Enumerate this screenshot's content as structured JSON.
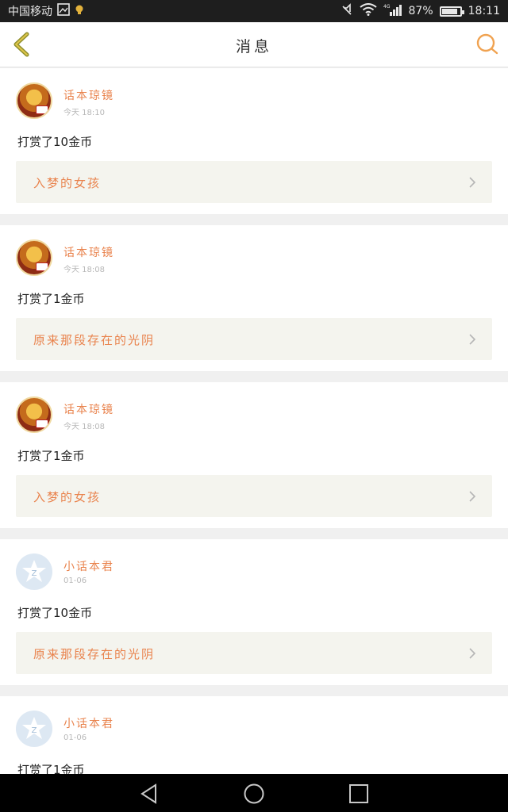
{
  "status_bar": {
    "carrier": "中国移动",
    "network": "4G",
    "battery": "87%",
    "battery_level": 0.87,
    "time": "18:11"
  },
  "header": {
    "title": "消息",
    "back_icon": "chevron-left-icon",
    "search_icon": "search-icon"
  },
  "colors": {
    "accent": "#e9834d",
    "back_icon": "#9a9a3c",
    "card_bg": "#ffffff",
    "story_bg": "#f4f4ee",
    "page_bg": "#f0f0f0"
  },
  "messages": [
    {
      "user": "话本琼镜",
      "time": "今天 18:10",
      "action": "打赏了10金币",
      "story": "入梦的女孩",
      "avatar": "photo"
    },
    {
      "user": "话本琼镜",
      "time": "今天 18:08",
      "action": "打赏了1金币",
      "story": "原来那段存在的光阴",
      "avatar": "photo"
    },
    {
      "user": "话本琼镜",
      "time": "今天 18:08",
      "action": "打赏了1金币",
      "story": "入梦的女孩",
      "avatar": "photo"
    },
    {
      "user": "小话本君",
      "time": "01-06",
      "action": "打赏了10金币",
      "story": "原来那段存在的光阴",
      "avatar": "default"
    },
    {
      "user": "小话本君",
      "time": "01-06",
      "action": "打赏了1金币",
      "story": "",
      "avatar": "default"
    }
  ],
  "nav_bar": {
    "back": "triangle-back-icon",
    "home": "circle-home-icon",
    "recent": "square-recent-icon"
  }
}
